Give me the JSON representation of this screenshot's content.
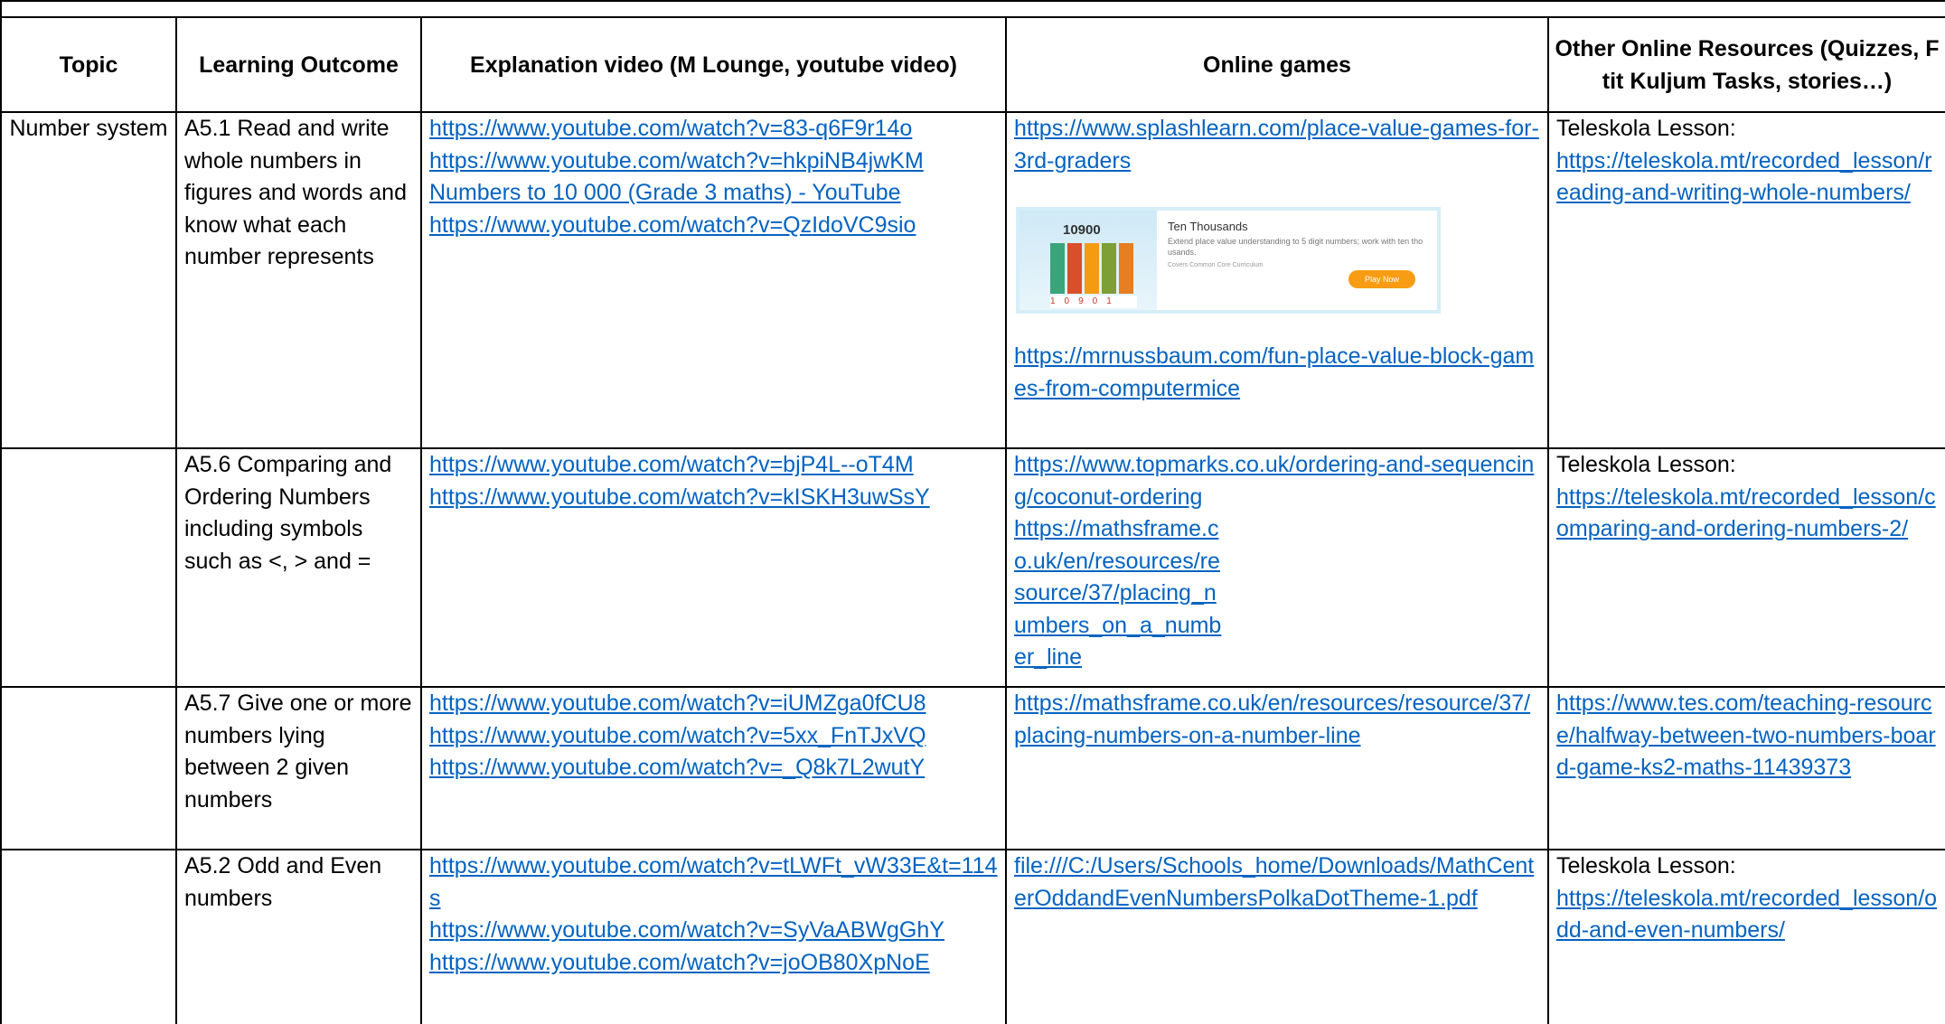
{
  "table": {
    "headers": [
      "Topic",
      "Learning Outcome",
      "Explanation video (M Lounge, youtube video)",
      "Online games",
      "Other Online Resources (Quizzes, Ftit Kuljum Tasks, stories…)"
    ],
    "rows": [
      {
        "topic": "Number system",
        "outcome": "A5.1  Read and write whole numbers in figures and words and know what each number represents",
        "videos": [
          "https://www.youtube.com/watch?v=83-q6F9r14o",
          "https://www.youtube.com/watch?v=hkpiNB4jwKM",
          "Numbers to 10 000 (Grade 3 maths) - YouTube",
          "https://www.youtube.com/watch?v=QzIdoVC9sio"
        ],
        "games_link_1": "https://www.splashlearn.com/place-value-games-for-3rd-graders",
        "preview": {
          "title": "Ten Thousands",
          "description": "Extend place value understanding to 5 digit numbers; work with ten thousands.",
          "meta": "Covers Common Core Curriculum",
          "number": "10900",
          "digits": "10901",
          "button": "Play Now",
          "bar_colors": [
            "#3aa57a",
            "#d94f2b",
            "#f39c12",
            "#7d9f35",
            "#e67e22"
          ],
          "accent": "#f89d13"
        },
        "games_link_2": "https://mrnussbaum.com/fun-place-value-block-games-from-computermice",
        "other_label": "Teleskola Lesson:",
        "other_link": "https://teleskola.mt/recorded_lesson/reading-and-writing-whole-numbers/"
      },
      {
        "topic": "",
        "outcome": "A5.6  Comparing and Ordering Numbers including symbols such as <, > and =",
        "videos": [
          "https://www.youtube.com/watch?v=bjP4L--oT4M",
          "https://www.youtube.com/watch?v=kISKH3uwSsY"
        ],
        "games": [
          "https://www.topmarks.co.uk/ordering-and-sequencing/coconut-ordering",
          "https://mathsframe.co.uk/en/resources/resource/37/placing_numbers_on_a_number_line"
        ],
        "other_label": "Teleskola Lesson:",
        "other_link": "https://teleskola.mt/recorded_lesson/comparing-and-ordering-numbers-2/"
      },
      {
        "topic": "",
        "outcome": "A5.7  Give one or more numbers lying between 2 given numbers",
        "videos": [
          "https://www.youtube.com/watch?v=iUMZga0fCU8",
          "https://www.youtube.com/watch?v=5xx_FnTJxVQ",
          "https://www.youtube.com/watch?v=_Q8k7L2wutY"
        ],
        "games": [
          "https://mathsframe.co.uk/en/resources/resource/37/placing-numbers-on-a-number-line"
        ],
        "other_link": "https://www.tes.com/teaching-resource/halfway-between-two-numbers-board-game-ks2-maths-11439373"
      },
      {
        "topic": "",
        "outcome": "A5.2  Odd and Even numbers",
        "videos": [
          "https://www.youtube.com/watch?v=tLWFt_vW33E&t=114s",
          "https://www.youtube.com/watch?v=SyVaABWgGhY",
          "https://www.youtube.com/watch?v=joOB80XpNoE"
        ],
        "games": [
          "file:///C:/Users/Schools_home/Downloads/MathCenterOddandEvenNumbersPolkaDotTheme-1.pdf"
        ],
        "other_label": "Teleskola Lesson:",
        "other_link": "https://teleskola.mt/recorded_lesson/odd-and-even-numbers/"
      }
    ]
  }
}
